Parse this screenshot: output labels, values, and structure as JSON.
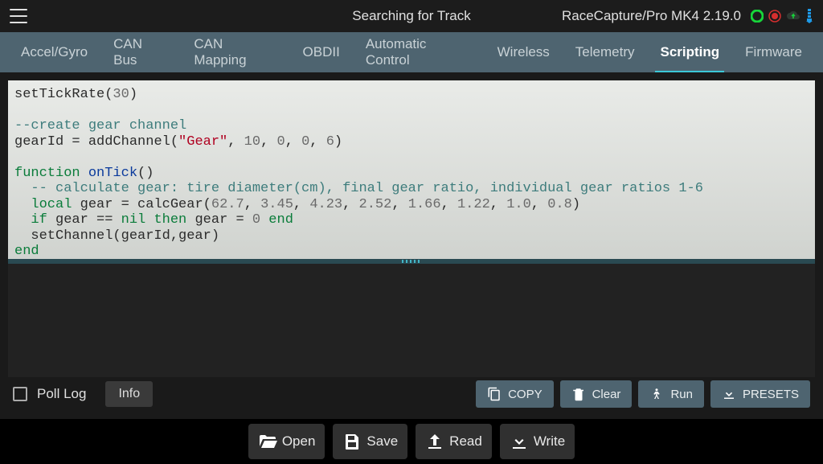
{
  "header": {
    "title": "Searching for Track",
    "device": "RaceCapture/Pro MK4 2.19.0"
  },
  "status_colors": {
    "record": "#17d43a",
    "gps": "#d62f2f",
    "cloud": "#2f3a33",
    "signal": "#1d9ae8"
  },
  "tabs": [
    {
      "id": "accel",
      "label": "Accel/Gyro",
      "active": false
    },
    {
      "id": "canbus",
      "label": "CAN Bus",
      "active": false
    },
    {
      "id": "canmap",
      "label": "CAN Mapping",
      "active": false
    },
    {
      "id": "obdii",
      "label": "OBDII",
      "active": false
    },
    {
      "id": "auto",
      "label": "Automatic Control",
      "active": false
    },
    {
      "id": "wireless",
      "label": "Wireless",
      "active": false
    },
    {
      "id": "telemetry",
      "label": "Telemetry",
      "active": false
    },
    {
      "id": "scripting",
      "label": "Scripting",
      "active": true
    },
    {
      "id": "firmware",
      "label": "Firmware",
      "active": false
    }
  ],
  "code": {
    "lines": [
      [
        {
          "t": "setTickRate",
          "c": "punc"
        },
        {
          "t": "(",
          "c": "punc"
        },
        {
          "t": "30",
          "c": "num"
        },
        {
          "t": ")",
          "c": "punc"
        }
      ],
      [],
      [
        {
          "t": "--create gear channel",
          "c": "cmt"
        }
      ],
      [
        {
          "t": "gearId ",
          "c": "punc"
        },
        {
          "t": "=",
          "c": "op"
        },
        {
          "t": " addChannel",
          "c": "punc"
        },
        {
          "t": "(",
          "c": "punc"
        },
        {
          "t": "\"Gear\"",
          "c": "str"
        },
        {
          "t": ", ",
          "c": "punc"
        },
        {
          "t": "10",
          "c": "num"
        },
        {
          "t": ", ",
          "c": "punc"
        },
        {
          "t": "0",
          "c": "num"
        },
        {
          "t": ", ",
          "c": "punc"
        },
        {
          "t": "0",
          "c": "num"
        },
        {
          "t": ", ",
          "c": "punc"
        },
        {
          "t": "6",
          "c": "num"
        },
        {
          "t": ")",
          "c": "punc"
        }
      ],
      [],
      [
        {
          "t": "function",
          "c": "kw"
        },
        {
          "t": " ",
          "c": "punc"
        },
        {
          "t": "onTick",
          "c": "fn"
        },
        {
          "t": "()",
          "c": "punc"
        }
      ],
      [
        {
          "t": "  -- calculate gear: tire diameter(cm), final gear ratio, individual gear ratios 1-6",
          "c": "cmt"
        }
      ],
      [
        {
          "t": "  ",
          "c": "punc"
        },
        {
          "t": "local",
          "c": "kw"
        },
        {
          "t": " gear ",
          "c": "punc"
        },
        {
          "t": "=",
          "c": "op"
        },
        {
          "t": " calcGear(",
          "c": "punc"
        },
        {
          "t": "62.7",
          "c": "num"
        },
        {
          "t": ", ",
          "c": "punc"
        },
        {
          "t": "3.45",
          "c": "num"
        },
        {
          "t": ", ",
          "c": "punc"
        },
        {
          "t": "4.23",
          "c": "num"
        },
        {
          "t": ", ",
          "c": "punc"
        },
        {
          "t": "2.52",
          "c": "num"
        },
        {
          "t": ", ",
          "c": "punc"
        },
        {
          "t": "1.66",
          "c": "num"
        },
        {
          "t": ", ",
          "c": "punc"
        },
        {
          "t": "1.22",
          "c": "num"
        },
        {
          "t": ", ",
          "c": "punc"
        },
        {
          "t": "1.0",
          "c": "num"
        },
        {
          "t": ", ",
          "c": "punc"
        },
        {
          "t": "0.8",
          "c": "num"
        },
        {
          "t": ")",
          "c": "punc"
        }
      ],
      [
        {
          "t": "  ",
          "c": "punc"
        },
        {
          "t": "if",
          "c": "kw"
        },
        {
          "t": " gear ",
          "c": "punc"
        },
        {
          "t": "==",
          "c": "op"
        },
        {
          "t": " ",
          "c": "punc"
        },
        {
          "t": "nil",
          "c": "kw"
        },
        {
          "t": " ",
          "c": "punc"
        },
        {
          "t": "then",
          "c": "kw"
        },
        {
          "t": " gear ",
          "c": "punc"
        },
        {
          "t": "=",
          "c": "op"
        },
        {
          "t": " ",
          "c": "punc"
        },
        {
          "t": "0",
          "c": "num"
        },
        {
          "t": " ",
          "c": "punc"
        },
        {
          "t": "end",
          "c": "kw"
        }
      ],
      [
        {
          "t": "  setChannel(gearId,gear)",
          "c": "punc"
        }
      ],
      [
        {
          "t": "end",
          "c": "kw"
        }
      ]
    ]
  },
  "controls": {
    "poll_log": "Poll Log",
    "info": "Info",
    "copy": "COPY",
    "clear": "Clear",
    "run": "Run",
    "presets": "PRESETS"
  },
  "bottom": {
    "open": "Open",
    "save": "Save",
    "read": "Read",
    "write": "Write"
  }
}
